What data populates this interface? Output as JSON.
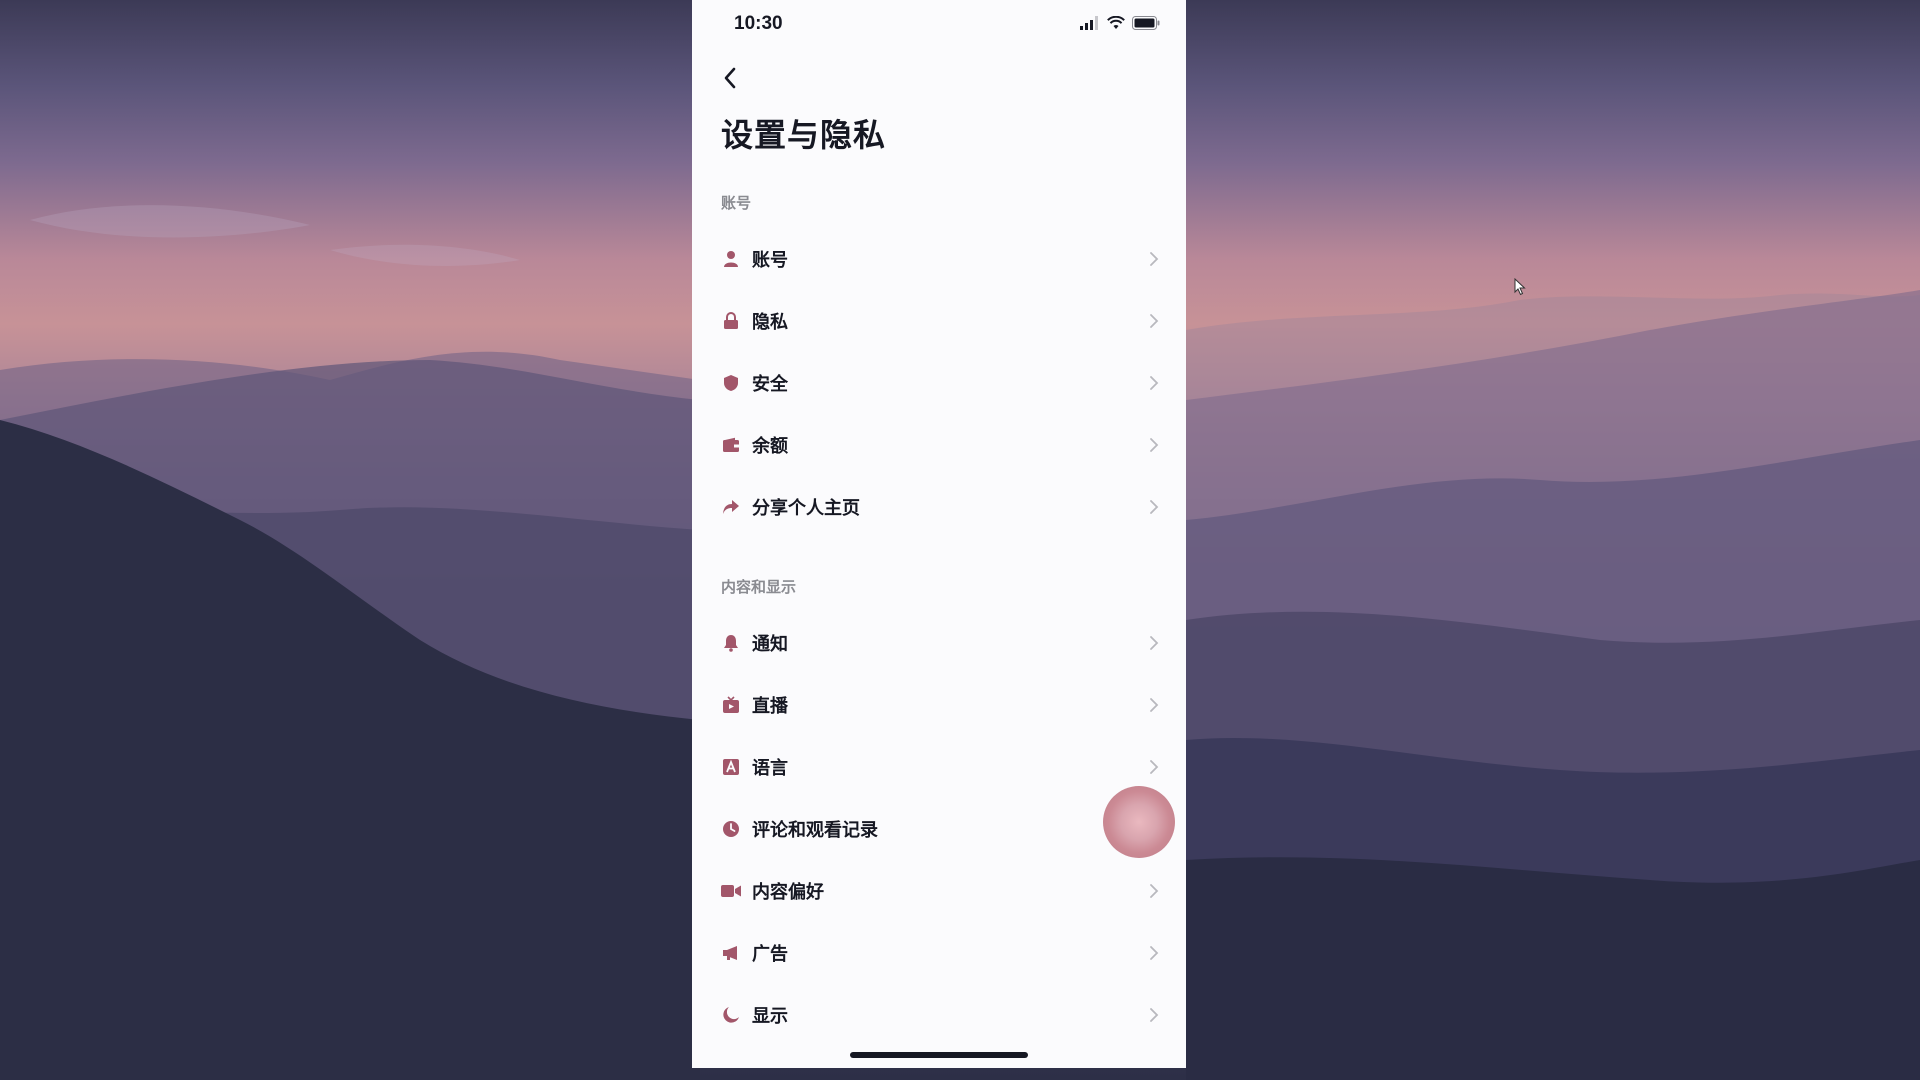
{
  "status_bar": {
    "time": "10:30",
    "signal_icon": "cellular-signal-icon",
    "wifi_icon": "wifi-icon",
    "battery_icon": "battery-icon"
  },
  "header": {
    "back_icon": "chevron-left-icon",
    "title": "设置与隐私"
  },
  "sections": [
    {
      "header": "账号",
      "items": [
        {
          "label": "账号",
          "icon": "person-icon"
        },
        {
          "label": "隐私",
          "icon": "lock-icon"
        },
        {
          "label": "安全",
          "icon": "shield-icon"
        },
        {
          "label": "余额",
          "icon": "wallet-icon"
        },
        {
          "label": "分享个人主页",
          "icon": "share-icon"
        }
      ]
    },
    {
      "header": "内容和显示",
      "items": [
        {
          "label": "通知",
          "icon": "bell-icon"
        },
        {
          "label": "直播",
          "icon": "live-tv-icon"
        },
        {
          "label": "语言",
          "icon": "language-icon"
        },
        {
          "label": "评论和观看记录",
          "icon": "clock-icon"
        },
        {
          "label": "内容偏好",
          "icon": "video-camera-icon"
        },
        {
          "label": "广告",
          "icon": "megaphone-icon"
        },
        {
          "label": "显示",
          "icon": "moon-icon"
        }
      ]
    }
  ],
  "colors": {
    "panel_bg": "#fbfbfd",
    "text_primary": "#161823",
    "text_secondary": "#8a8b91",
    "icon_color": "#a2566a",
    "touch_indicator": "#d7a0aa"
  }
}
